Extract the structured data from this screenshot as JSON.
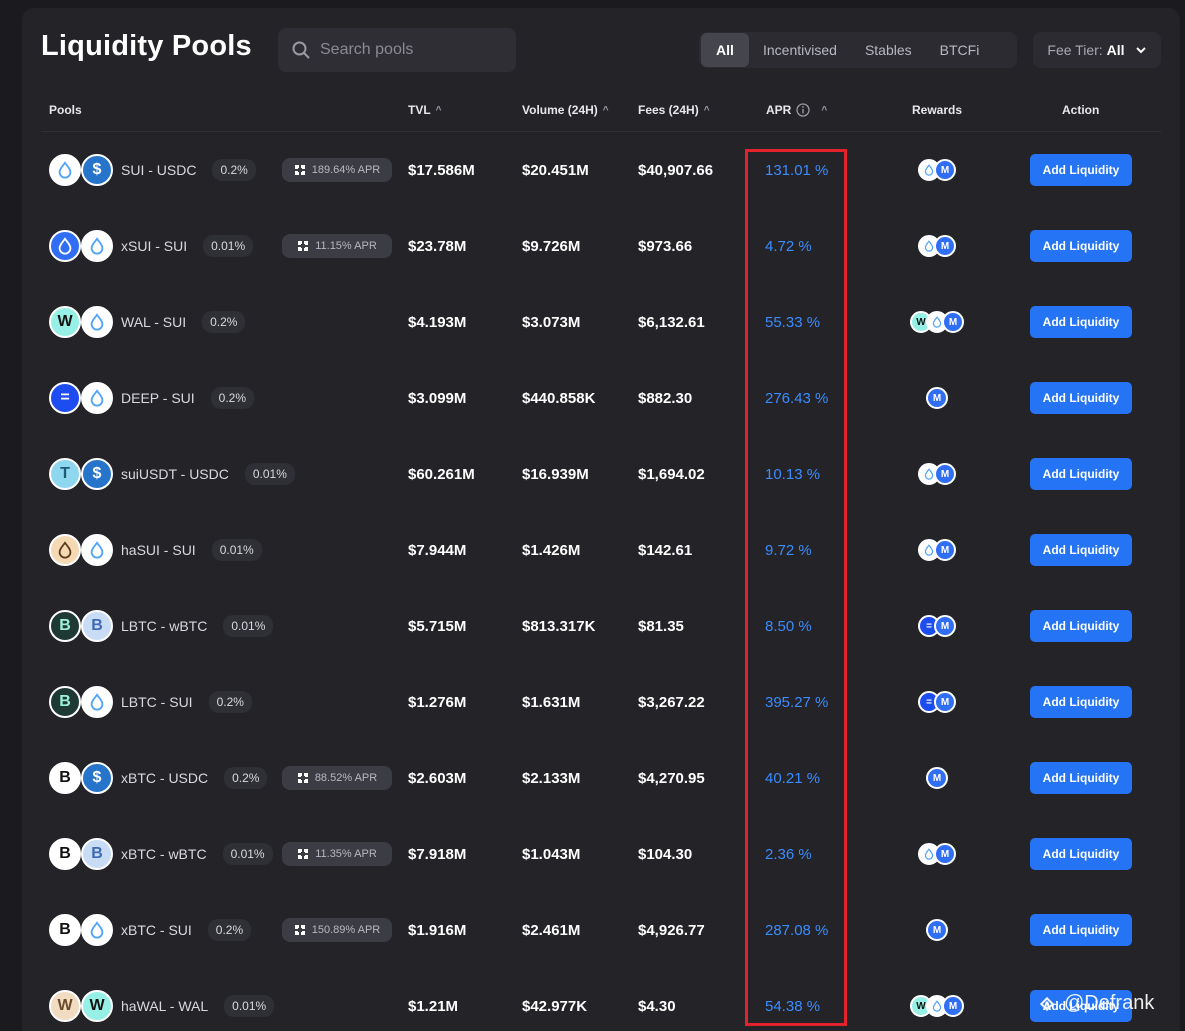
{
  "title": "Liquidity Pools",
  "search": {
    "placeholder": "Search pools"
  },
  "filters": [
    {
      "label": "All",
      "active": true
    },
    {
      "label": "Incentivised",
      "active": false
    },
    {
      "label": "Stables",
      "active": false
    },
    {
      "label": "BTCFi",
      "active": false
    }
  ],
  "fee_tier": {
    "label": "Fee Tier:",
    "value": "All"
  },
  "columns": {
    "pools": "Pools",
    "tvl": "TVL",
    "volume": "Volume (24H)",
    "fees": "Fees (24H)",
    "apr": "APR",
    "rewards": "Rewards",
    "action": "Action"
  },
  "colors": {
    "accent": "#2574f5",
    "apr_text": "#3b8cff",
    "highlight": "#e3222b",
    "background": "#232328"
  },
  "rows": [
    {
      "pair": "SUI - USDC",
      "fee": "0.2%",
      "bonus": "189.64% APR",
      "tvl": "$17.586M",
      "volume": "$20.451M",
      "fees": "$40,907.66",
      "apr": "131.01 %",
      "tokens": [
        "sui",
        "usdc"
      ],
      "rewards": [
        "sui",
        "mmt"
      ],
      "action": "Add Liquidity"
    },
    {
      "pair": "xSUI - SUI",
      "fee": "0.01%",
      "bonus": "11.15% APR",
      "tvl": "$23.78M",
      "volume": "$9.726M",
      "fees": "$973.66",
      "apr": "4.72 %",
      "tokens": [
        "xsui",
        "sui"
      ],
      "rewards": [
        "sui",
        "mmt"
      ],
      "action": "Add Liquidity"
    },
    {
      "pair": "WAL - SUI",
      "fee": "0.2%",
      "bonus": "",
      "tvl": "$4.193M",
      "volume": "$3.073M",
      "fees": "$6,132.61",
      "apr": "55.33 %",
      "tokens": [
        "wal",
        "sui"
      ],
      "rewards": [
        "wal",
        "sui",
        "mmt"
      ],
      "action": "Add Liquidity"
    },
    {
      "pair": "DEEP - SUI",
      "fee": "0.2%",
      "bonus": "",
      "tvl": "$3.099M",
      "volume": "$440.858K",
      "fees": "$882.30",
      "apr": "276.43 %",
      "tokens": [
        "deep",
        "sui"
      ],
      "rewards": [
        "mmt"
      ],
      "action": "Add Liquidity"
    },
    {
      "pair": "suiUSDT - USDC",
      "fee": "0.01%",
      "bonus": "",
      "tvl": "$60.261M",
      "volume": "$16.939M",
      "fees": "$1,694.02",
      "apr": "10.13 %",
      "tokens": [
        "usdt",
        "usdc"
      ],
      "rewards": [
        "sui",
        "mmt"
      ],
      "action": "Add Liquidity"
    },
    {
      "pair": "haSUI - SUI",
      "fee": "0.01%",
      "bonus": "",
      "tvl": "$7.944M",
      "volume": "$1.426M",
      "fees": "$142.61",
      "apr": "9.72 %",
      "tokens": [
        "hasui",
        "sui"
      ],
      "rewards": [
        "sui",
        "mmt"
      ],
      "action": "Add Liquidity"
    },
    {
      "pair": "LBTC - wBTC",
      "fee": "0.01%",
      "bonus": "",
      "tvl": "$5.715M",
      "volume": "$813.317K",
      "fees": "$81.35",
      "apr": "8.50 %",
      "tokens": [
        "lbtc",
        "wbtc"
      ],
      "rewards": [
        "deep",
        "mmt"
      ],
      "action": "Add Liquidity"
    },
    {
      "pair": "LBTC - SUI",
      "fee": "0.2%",
      "bonus": "",
      "tvl": "$1.276M",
      "volume": "$1.631M",
      "fees": "$3,267.22",
      "apr": "395.27 %",
      "tokens": [
        "lbtc",
        "sui"
      ],
      "rewards": [
        "deep",
        "mmt"
      ],
      "action": "Add Liquidity"
    },
    {
      "pair": "xBTC - USDC",
      "fee": "0.2%",
      "bonus": "88.52% APR",
      "tvl": "$2.603M",
      "volume": "$2.133M",
      "fees": "$4,270.95",
      "apr": "40.21 %",
      "tokens": [
        "xbtc",
        "usdc"
      ],
      "rewards": [
        "mmt"
      ],
      "action": "Add Liquidity"
    },
    {
      "pair": "xBTC - wBTC",
      "fee": "0.01%",
      "bonus": "11.35% APR",
      "tvl": "$7.918M",
      "volume": "$1.043M",
      "fees": "$104.30",
      "apr": "2.36 %",
      "tokens": [
        "xbtc",
        "wbtc"
      ],
      "rewards": [
        "sui",
        "mmt"
      ],
      "action": "Add Liquidity"
    },
    {
      "pair": "xBTC - SUI",
      "fee": "0.2%",
      "bonus": "150.89% APR",
      "tvl": "$1.916M",
      "volume": "$2.461M",
      "fees": "$4,926.77",
      "apr": "287.08 %",
      "tokens": [
        "xbtc",
        "sui"
      ],
      "rewards": [
        "mmt"
      ],
      "action": "Add Liquidity"
    },
    {
      "pair": "haWAL - WAL",
      "fee": "0.01%",
      "bonus": "",
      "tvl": "$1.21M",
      "volume": "$42.977K",
      "fees": "$4.30",
      "apr": "54.38 %",
      "tokens": [
        "hawal",
        "wal"
      ],
      "rewards": [
        "wal",
        "sui",
        "mmt"
      ],
      "action": "Add Liquidity"
    }
  ],
  "watermark": "@Defrank"
}
